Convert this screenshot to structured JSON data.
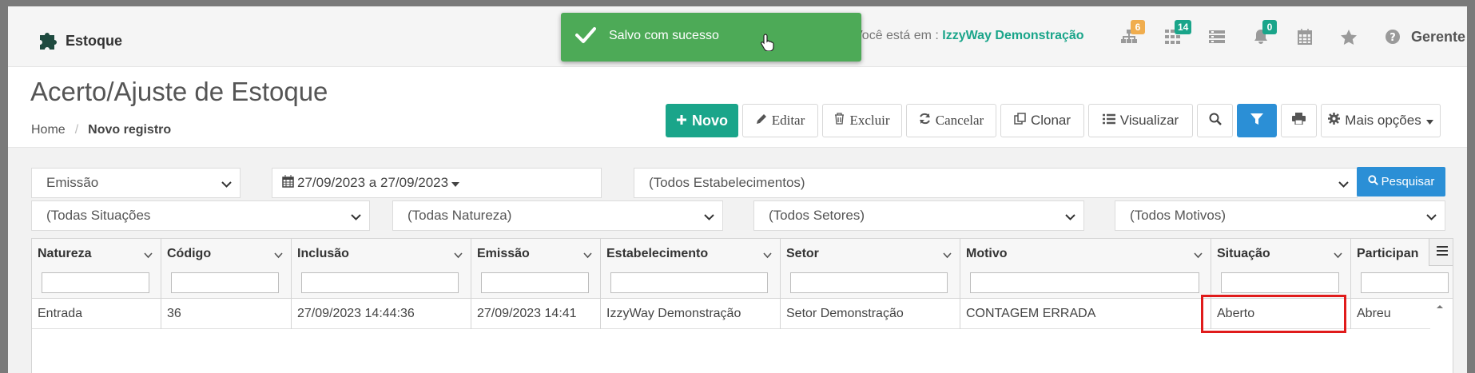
{
  "app": {
    "name": "Estoque"
  },
  "header": {
    "location_prefix": "Você está em :",
    "location_company": "IzzyWay Demonstração",
    "badges": {
      "sitemap": "6",
      "grid": "14",
      "notifications": "0"
    },
    "icons": [
      "sitemap-icon",
      "grid-icon",
      "list-icon",
      "bell-icon",
      "calendar-icon",
      "star-icon",
      "help-icon"
    ],
    "user": "Gerente"
  },
  "toast": {
    "message": "Salvo com sucesso"
  },
  "page": {
    "title": "Acerto/Ajuste de Estoque",
    "breadcrumb": {
      "home": "Home",
      "separator": "/",
      "current": "Novo registro"
    }
  },
  "toolbar": {
    "novo": "Novo",
    "editar": "Editar",
    "excluir": "Excluir",
    "cancelar": "Cancelar",
    "clonar": "Clonar",
    "visualizar": "Visualizar",
    "mais_opcoes": "Mais opções"
  },
  "filters": {
    "date_field": "Emissão",
    "date_range": "27/09/2023 a 27/09/2023",
    "estabelecimento": "(Todos Estabelecimentos)",
    "search_button": "Pesquisar",
    "situacao": "(Todas Situações",
    "natureza": "(Todas Natureza)",
    "setores": "(Todos Setores)",
    "motivos": "(Todos Motivos)"
  },
  "grid": {
    "columns": [
      "Natureza",
      "Código",
      "Inclusão",
      "Emissão",
      "Estabelecimento",
      "Setor",
      "Motivo",
      "Situação",
      "Participan"
    ],
    "rows": [
      [
        "Entrada",
        "36",
        "27/09/2023 14:44:36",
        "27/09/2023 14:41",
        "IzzyWay Demonstração",
        "Setor Demonstração",
        "CONTAGEM ERRADA",
        "Aberto",
        "Abreu"
      ]
    ]
  },
  "colors": {
    "accent": "#1aa58a",
    "primary_blue": "#2b8fd6",
    "toast_green": "#4daa57",
    "highlight": "#e01b1b"
  }
}
